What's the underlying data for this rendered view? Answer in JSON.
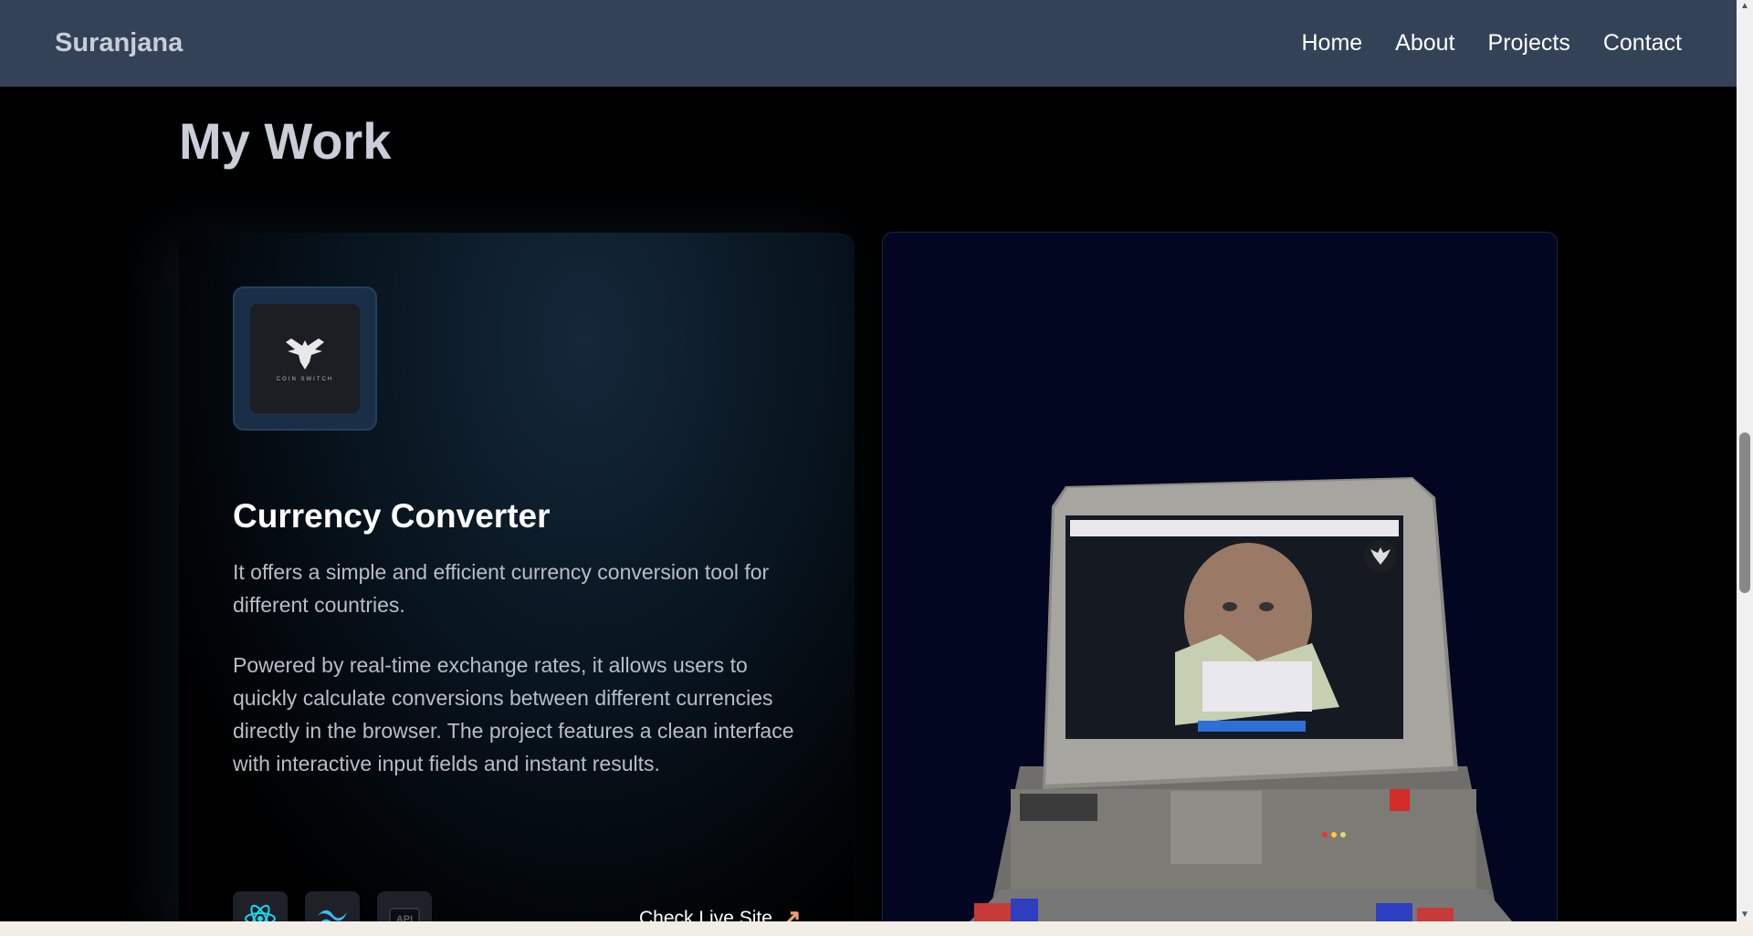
{
  "nav": {
    "brand": "Suranjana",
    "links": [
      "Home",
      "About",
      "Projects",
      "Contact"
    ]
  },
  "section": {
    "title": "My Work"
  },
  "project": {
    "logo_text": "COIN SWITCH",
    "title": "Currency Converter",
    "description_1": "It offers a simple and efficient currency conversion tool for different countries.",
    "description_2": "Powered by real-time exchange rates, it allows users to quickly calculate conversions between different currencies directly in the browser. The project features a clean interface with interactive input fields and instant results.",
    "tech_icons": [
      "react-icon",
      "tailwind-icon",
      "api-icon"
    ],
    "api_label": "API",
    "live_link_label": "Check Live Site"
  },
  "colors": {
    "navbar": "#334257",
    "background": "#000000",
    "preview_bg": "#020621",
    "accent_arrow": "#f0a077"
  }
}
